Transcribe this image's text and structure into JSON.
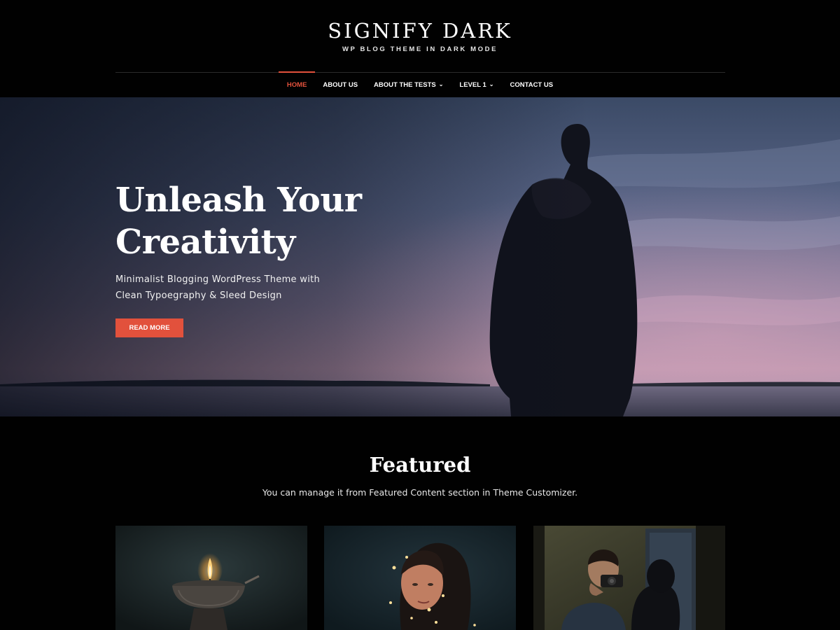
{
  "site": {
    "title": "SIGNIFY DARK",
    "tagline": "WP BLOG THEME IN DARK MODE"
  },
  "nav": {
    "items": [
      {
        "label": "HOME",
        "active": true,
        "has_children": false
      },
      {
        "label": "ABOUT US",
        "active": false,
        "has_children": false
      },
      {
        "label": "ABOUT THE TESTS",
        "active": false,
        "has_children": true
      },
      {
        "label": "LEVEL 1",
        "active": false,
        "has_children": true
      },
      {
        "label": "CONTACT US",
        "active": false,
        "has_children": false
      }
    ],
    "dropdown_icon": "chevron-down-icon"
  },
  "hero": {
    "title_line1": "Unleash Your",
    "title_line2": "Creativity",
    "text_line1": "Minimalist Blogging WordPress Theme with",
    "text_line2": "Clean Typoegraphy & Sleed Design",
    "button_label": "READ MORE"
  },
  "featured": {
    "title": "Featured",
    "subtitle": "You can manage it from Featured Content section in Theme Customizer.",
    "cards": [
      {
        "image": "candle-photo"
      },
      {
        "image": "woman-with-lights-photo"
      },
      {
        "image": "man-with-camera-photo"
      }
    ]
  },
  "colors": {
    "accent": "#e2513c",
    "background": "#010101",
    "text": "#ffffff"
  }
}
